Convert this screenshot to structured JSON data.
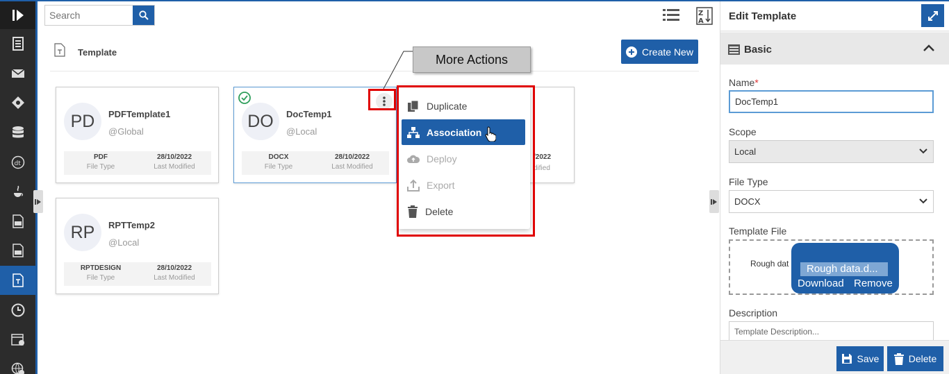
{
  "search": {
    "placeholder": "Search"
  },
  "page": {
    "title": "Template",
    "create_label": "Create New"
  },
  "cards": [
    {
      "initials": "PD",
      "name": "PDFTemplate1",
      "scope": "@Global",
      "file_type": "PDF",
      "file_type_label": "File Type",
      "modified": "28/10/2022",
      "modified_label": "Last Modified"
    },
    {
      "initials": "DO",
      "name": "DocTemp1",
      "scope": "@Local",
      "file_type": "DOCX",
      "file_type_label": "File Type",
      "modified": "28/10/2022",
      "modified_label": "Last Modified"
    },
    {
      "initials": "RP",
      "name": "RPTTemp2",
      "scope": "@Local",
      "file_type": "RPTDESIGN",
      "file_type_label": "File Type",
      "modified": "28/10/2022",
      "modified_label": "Last Modified"
    }
  ],
  "hidden_card": {
    "date_fragment": "/2022",
    "label_fragment": "dified"
  },
  "menu": {
    "items": [
      {
        "label": "Duplicate",
        "icon": "copy-icon",
        "state": "normal"
      },
      {
        "label": "Association",
        "icon": "hierarchy-icon",
        "state": "highlighted"
      },
      {
        "label": "Deploy",
        "icon": "cloud-upload-icon",
        "state": "disabled"
      },
      {
        "label": "Export",
        "icon": "upload-icon",
        "state": "disabled"
      },
      {
        "label": "Delete",
        "icon": "trash-icon",
        "state": "normal"
      }
    ]
  },
  "callout": {
    "text": "More Actions"
  },
  "panel": {
    "title": "Edit Template",
    "section": "Basic",
    "name_label": "Name",
    "name_required": "*",
    "name_value": "DocTemp1",
    "scope_label": "Scope",
    "scope_value": "Local",
    "filetype_label": "File Type",
    "filetype_value": "DOCX",
    "templatefile_label": "Template File",
    "file_behind": "Rough dat",
    "file_name": "Rough data.d...",
    "download_label": "Download",
    "remove_label": "Remove",
    "description_label": "Description",
    "description_placeholder": "Template Description...",
    "save_label": "Save",
    "delete_label": "Delete"
  },
  "colors": {
    "accent": "#1f5fa8",
    "highlight": "#e00000",
    "success": "#2e9e5b"
  }
}
